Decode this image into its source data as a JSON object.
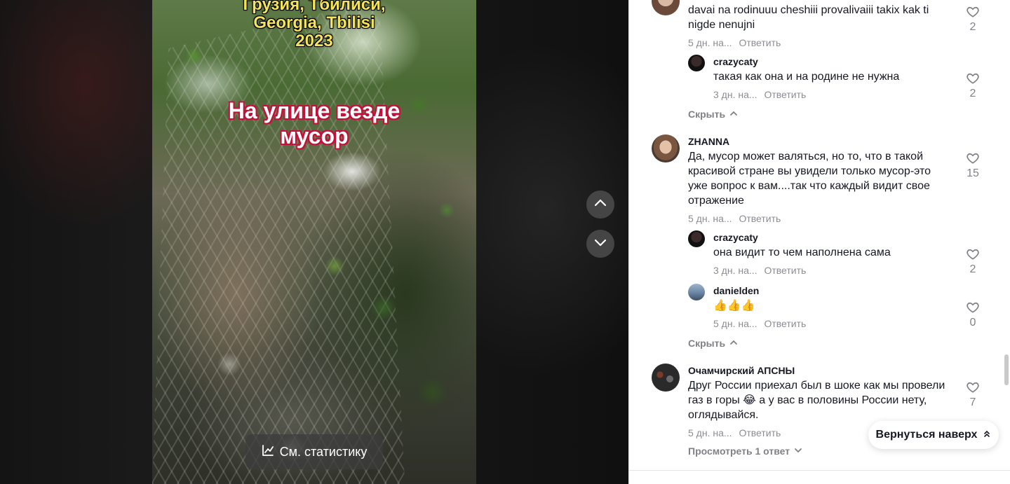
{
  "video": {
    "location_lines": [
      "Грузия, Тбилиси,",
      "Georgia, Tbilisi",
      "2023"
    ],
    "caption_lines": [
      "На улице везде",
      "мусор"
    ],
    "stats_label": "См. статистику"
  },
  "comments": [
    {
      "username": "",
      "text": "davai na rodinuuu cheshiii provalivaiii takix kak ti nigde nenujni",
      "time": "5 дн. на...",
      "reply": "Ответить",
      "likes": "2"
    },
    {
      "username": "crazycaty",
      "text": "такая как она и на родине не нужна",
      "time": "3 дн. на...",
      "reply": "Ответить",
      "likes": "2"
    },
    {
      "username": "ZHANNA",
      "text": "Да, мусор может валяться, но то, что в такой красивой стране вы увидели только мусор-это уже вопрос к вам....так что каждый видит свое отражение",
      "time": "5 дн. на...",
      "reply": "Ответить",
      "likes": "15"
    },
    {
      "username": "crazycaty",
      "text": "она видит то чем наполнена сама",
      "time": "3 дн. на...",
      "reply": "Ответить",
      "likes": "2"
    },
    {
      "username": "danielden",
      "text": "👍👍👍",
      "time": "5 дн. на...",
      "reply": "Ответить",
      "likes": "0"
    },
    {
      "username": "Очамчирский АПСНЫ",
      "text": "Друг России приехал был в шоке как мы провели газ в горы 😂 а у вас в половины России нету, оглядывайся.",
      "time": "5 дн. на...",
      "reply": "Ответить",
      "likes": "7"
    }
  ],
  "toggles": {
    "hide_1": "Скрыть",
    "hide_2": "Скрыть",
    "view_replies": "Просмотреть 1 ответ"
  },
  "back_to_top": "Вернуться наверх",
  "colors": {
    "location_text": "#f5e35a",
    "caption_outline": "#c4123a",
    "primary_text": "#161823"
  }
}
